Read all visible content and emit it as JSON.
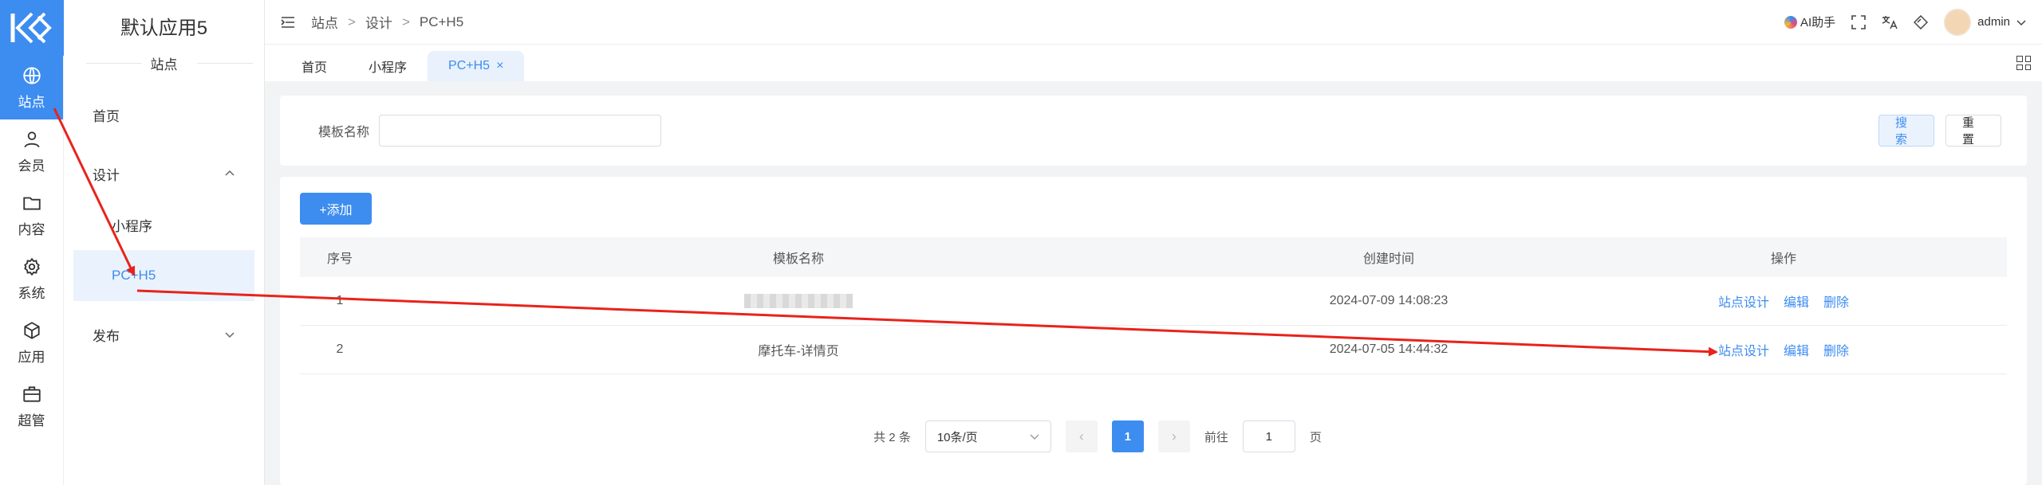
{
  "rail": {
    "items": [
      {
        "label": "站点",
        "icon": "globe-icon"
      },
      {
        "label": "会员",
        "icon": "user-icon"
      },
      {
        "label": "内容",
        "icon": "folder-icon"
      },
      {
        "label": "系统",
        "icon": "gear-icon"
      },
      {
        "label": "应用",
        "icon": "cube-icon"
      },
      {
        "label": "超管",
        "icon": "briefcase-icon"
      }
    ]
  },
  "sidebar": {
    "app_name": "默认应用5",
    "section_title": "站点",
    "home": "首页",
    "design": "设计",
    "mini_program": "小程序",
    "pc_h5": "PC+H5",
    "publish": "发布"
  },
  "header": {
    "breadcrumb": [
      "站点",
      "设计",
      "PC+H5"
    ],
    "breadcrumb_sep": ">",
    "ai_label": "AI助手",
    "username": "admin"
  },
  "tabs": [
    {
      "label": "首页"
    },
    {
      "label": "小程序"
    },
    {
      "label": "PC+H5",
      "close": "×"
    }
  ],
  "search": {
    "label": "模板名称",
    "value": "",
    "search_btn": "搜索",
    "reset_btn": "重置"
  },
  "add_button": "+添加",
  "table": {
    "headers": [
      "序号",
      "模板名称",
      "创建时间",
      "操作"
    ],
    "rows": [
      {
        "index": "1",
        "name": "",
        "created": "2024-07-09 14:08:23"
      },
      {
        "index": "2",
        "name": "摩托车-详情页",
        "created": "2024-07-05 14:44:32"
      }
    ],
    "actions": [
      "站点设计",
      "编辑",
      "删除"
    ]
  },
  "pager": {
    "total": "共 2 条",
    "page_size": "10条/页",
    "prev": "‹",
    "current": "1",
    "next": "›",
    "goto_label": "前往",
    "goto_value": "1",
    "goto_suffix": "页"
  },
  "colors": {
    "accent": "#3d8cf0",
    "annotation": "#e8231b"
  }
}
